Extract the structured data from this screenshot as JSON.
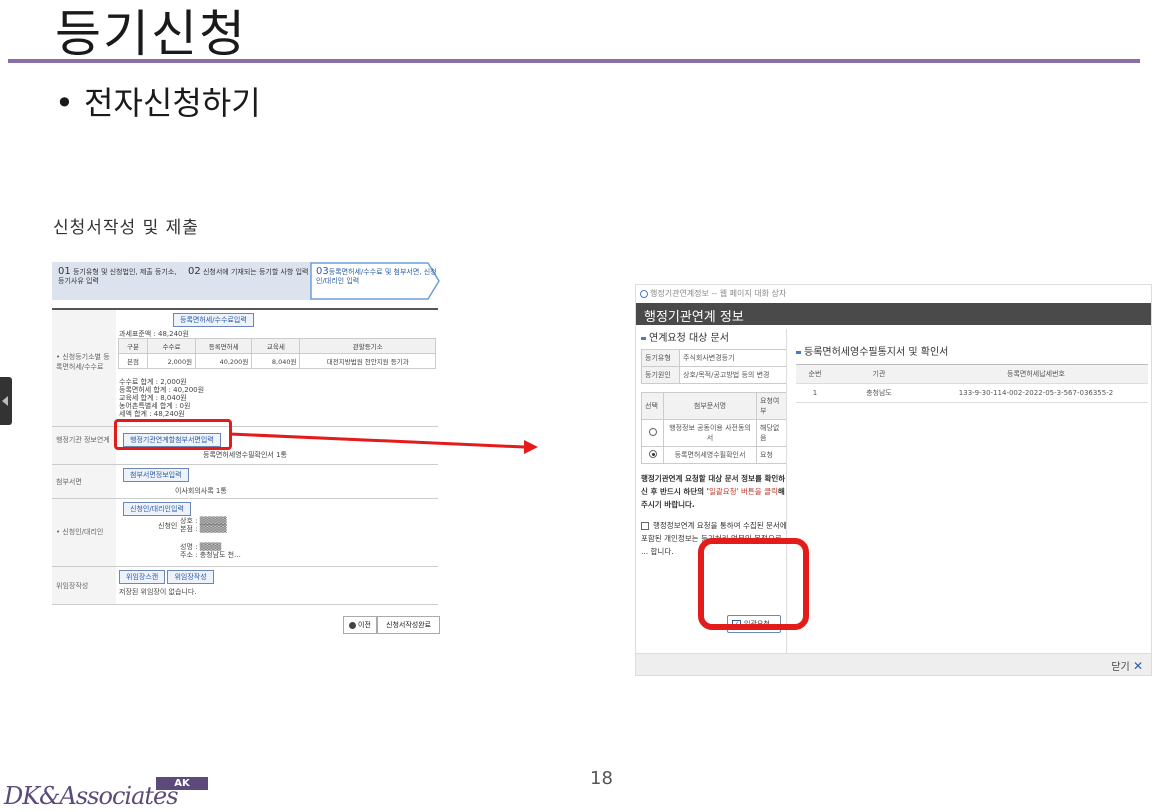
{
  "slide": {
    "title": "등기신청",
    "bullet": "• 전자신청하기",
    "section_heading": "신청서작성 및 제출",
    "page_number": "18",
    "logo_script": "DK&Associates",
    "logo_badge": "AK"
  },
  "steps": [
    {
      "num": "01",
      "label": "등기유형 및 신청법인, 제출 등기소, 등기사유 입력"
    },
    {
      "num": "02",
      "label": "신청서에 기재되는 등기할 사항 입력"
    },
    {
      "num": "03",
      "label": "등록면허세/수수료 및 첨부서면, 신청인/대리인 입력"
    }
  ],
  "form": {
    "fee_section_label": "• 신청등기소별 등록면허세/수수료",
    "fee_button": "등록면허세/수수료입력",
    "fee_standard": "과세표준액 : 48,240원",
    "fee_headers": [
      "구분",
      "수수료",
      "등록면허세",
      "교육세",
      "관할등기소"
    ],
    "fee_row": [
      "본점",
      "2,000원",
      "40,200원",
      "8,040원",
      "대전지방법원 천안지원 등기과"
    ],
    "fee_summary": [
      "수수료 합계 : 2,000원",
      "등록면허세 합계 : 40,200원",
      "교육세 합계 : 8,040원",
      "농어촌특별세 합계 : 0원",
      "세액 합계 : 48,240원"
    ],
    "admin_label": "행정기관 정보연계",
    "admin_button": "행정기관연계할첨부서면입력",
    "admin_value": "등록면허세영수필확인서 1통",
    "attach_label": "첨부서면",
    "attach_button": "첨부서면정보입력",
    "attach_value": "이사회의사록 1통",
    "applicant_label": "• 신청인/대리인",
    "applicant_button": "신청인/대리인입력",
    "applicant_role": "신청인",
    "applicant_lines": [
      "상호 : ▒▒▒▒▒",
      "본점 : ▒▒▒▒▒"
    ],
    "agent_lines": [
      "성명 : ▒▒▒▒",
      "주소 : 충청남도 천..."
    ],
    "delegation_label": "위임장작성",
    "delegation_buttons": [
      "위임장스캔",
      "위임장작성"
    ],
    "delegation_value": "저장된 위임장이 없습니다.",
    "prev_button": "이전",
    "done_button": "신청서작성완료"
  },
  "popup": {
    "window_title": "행정기관연계정보 -- 웹 페이지 대화 상자",
    "header": "행정기관연계 정보",
    "left_title": "연계요청 대상 문서",
    "reg_type_label": "등기유형",
    "reg_type_value": "주식회사변경등기",
    "reg_reason_label": "등기원인",
    "reg_reason_value": "상호/목적/공고방법 등의 변경",
    "doc_headers": [
      "선택",
      "첨부문서명",
      "요청여부"
    ],
    "docs": [
      {
        "name": "행정정보 공동이용 사전동의서",
        "status": "해당없음",
        "selected": false
      },
      {
        "name": "등록면허세영수필확인서",
        "status": "요청",
        "selected": true
      }
    ],
    "note_main": "행정기관연계 요청할 대상 문서 정보를 확인하신 후 반드시 하단의 '",
    "note_red": "일괄요청' 버튼을 클릭",
    "note_end": "해 주시기 바랍니다.",
    "consent_text": "행정정보연계 요청을 통하여 수집된 문서에 포함된 개인정보는 등기처리 업무의 목적으로 ... 합니다.",
    "bulk_button": "일괄요청",
    "right_title": "등록면허세영수필통지서 및 확인서",
    "right_headers": [
      "순번",
      "기관",
      "등록면허세납세번호"
    ],
    "right_rows": [
      [
        "1",
        "충청남도",
        "133-9-30-114-002-2022-05-3-567-036355-2"
      ]
    ],
    "close_button": "닫기"
  },
  "colors": {
    "accent_purple": "#8a6fa6",
    "highlight_red": "#e31b1b",
    "link_blue": "#2a5ca8"
  }
}
